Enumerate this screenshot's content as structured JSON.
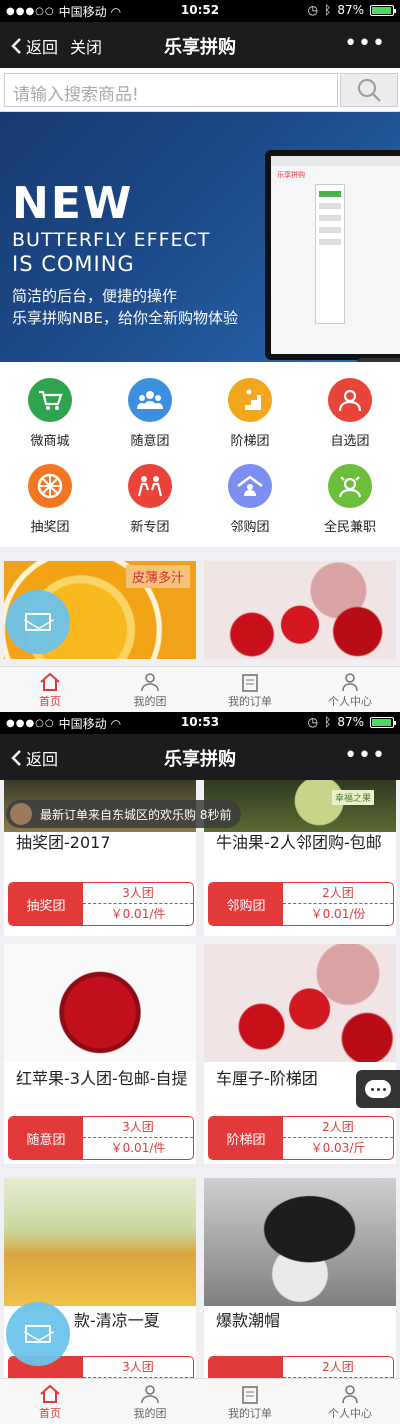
{
  "screen1": {
    "status": {
      "carrier": "中国移动",
      "time": "10:52",
      "battery": "87%"
    },
    "nav": {
      "back": "返回",
      "close": "关闭",
      "title": "乐享拼购",
      "more": "•••"
    },
    "search": {
      "placeholder": "请输入搜索商品!"
    },
    "banner": {
      "line1": "NEW",
      "line2": "BUTTERFLY EFFECT",
      "line3": "IS COMING",
      "line4": "简洁的后台，便捷的操作",
      "line5": "乐享拼购NBE，给你全新购物体验",
      "screen_logo": "乐享拼购"
    },
    "categories": [
      {
        "label": "微商城",
        "icon": "cart-icon",
        "color": "#2ea44f"
      },
      {
        "label": "随意团",
        "icon": "people-group-icon",
        "color": "#3d8fe0"
      },
      {
        "label": "阶梯团",
        "icon": "stairs-icon",
        "color": "#f3a71f"
      },
      {
        "label": "自选团",
        "icon": "person-select-icon",
        "color": "#e8443a"
      },
      {
        "label": "抽奖团",
        "icon": "lottery-wheel-icon",
        "color": "#f37621"
      },
      {
        "label": "新专团",
        "icon": "new-member-icon",
        "color": "#e8443a"
      },
      {
        "label": "邻购团",
        "icon": "neighborhood-icon",
        "color": "#7c8ef0"
      },
      {
        "label": "全民兼职",
        "icon": "parttime-icon",
        "color": "#6cbf3a"
      }
    ],
    "promo": {
      "label": "皮薄多汁"
    }
  },
  "screen2": {
    "status": {
      "carrier": "中国移动",
      "time": "10:53",
      "battery": "87%"
    },
    "nav": {
      "back": "返回",
      "title": "乐享拼购",
      "more": "•••"
    },
    "notice": "最新订单来自东城区的欢乐购 8秒前",
    "promo": {
      "label": "幸福之果"
    },
    "products": [
      {
        "name": "抽奖团-2017",
        "type": "抽奖团",
        "group": "3人团",
        "price": "￥0.01/件"
      },
      {
        "name": "牛油果-2人邻团购-包邮",
        "type": "邻购团",
        "group": "2人团",
        "price": "￥0.01/份"
      },
      {
        "name": "红苹果-3人团-包邮-自提",
        "type": "随意团",
        "group": "3人团",
        "price": "￥0.01/件"
      },
      {
        "name": "车厘子-阶梯团",
        "type": "阶梯团",
        "group": "2人团",
        "price": "￥0.03/斤"
      },
      {
        "name": "款-清凉一夏",
        "type": "",
        "group": "3人团",
        "price": ""
      },
      {
        "name": "爆款潮帽",
        "type": "",
        "group": "2人团",
        "price": ""
      }
    ]
  },
  "tabbar": [
    {
      "label": "首页",
      "icon": "home-icon"
    },
    {
      "label": "我的团",
      "icon": "my-group-icon"
    },
    {
      "label": "我的订单",
      "icon": "orders-icon"
    },
    {
      "label": "个人中心",
      "icon": "profile-icon"
    }
  ],
  "colors": {
    "accent": "#e23a3a",
    "nav": "#1c1c1f",
    "active_tab": "#e23a3a",
    "mail": "#6ec3ea"
  }
}
